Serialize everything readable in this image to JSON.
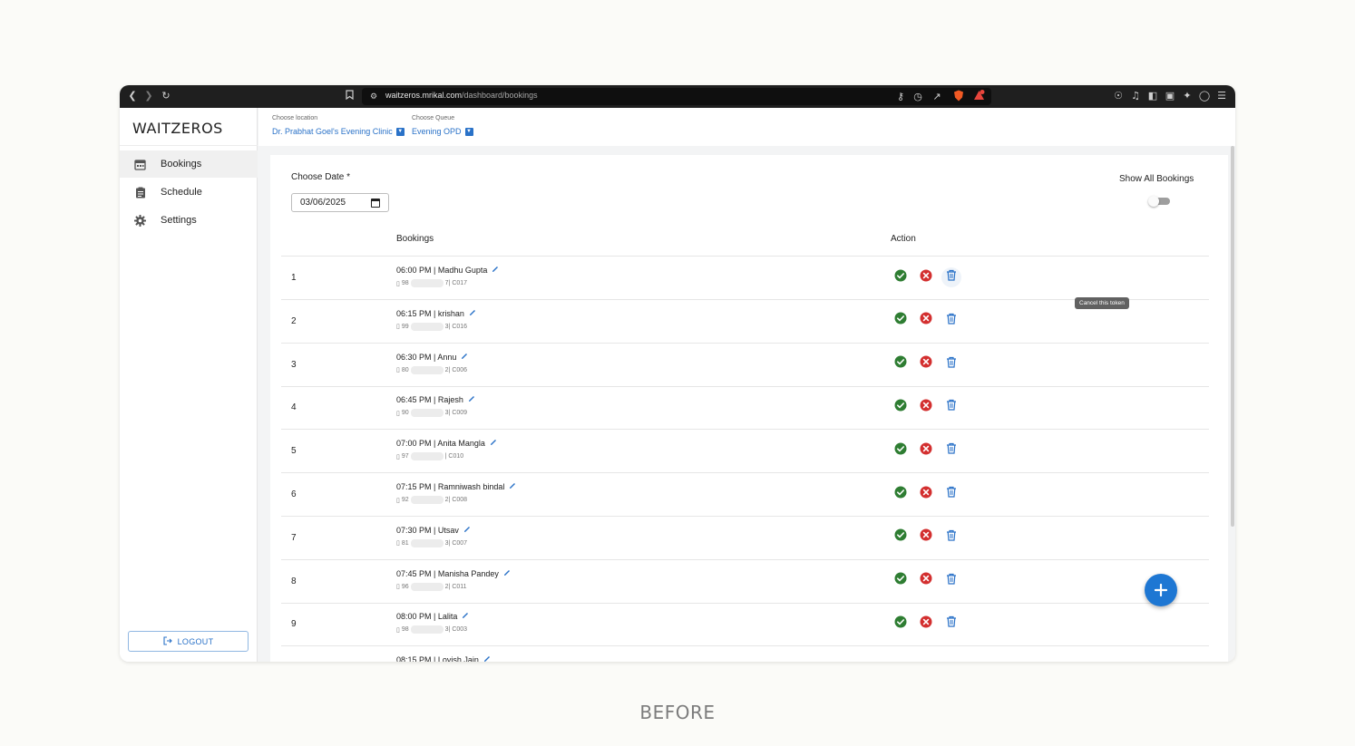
{
  "browser": {
    "url_host": "waitzeros.mrikal.com",
    "url_path": "/dashboard/bookings"
  },
  "sidebar": {
    "brand": "WAITZEROS",
    "items": [
      {
        "label": "Bookings",
        "icon": "calendar-icon",
        "active": true
      },
      {
        "label": "Schedule",
        "icon": "clipboard-icon",
        "active": false
      },
      {
        "label": "Settings",
        "icon": "gear-icon",
        "active": false
      }
    ],
    "logout_label": "LOGOUT"
  },
  "topbar": {
    "location_label": "Choose location",
    "location_value": "Dr. Prabhat Goel's Evening Clinic",
    "queue_label": "Choose Queue",
    "queue_value": "Evening OPD"
  },
  "filters": {
    "date_label": "Choose Date *",
    "date_value": "03/06/2025",
    "show_all_label": "Show All Bookings",
    "show_all_on": false
  },
  "table": {
    "headers": {
      "bookings": "Bookings",
      "action": "Action"
    },
    "rows": [
      {
        "index": "1",
        "title": "06:00 PM | Madhu Gupta",
        "phone_prefix": "98",
        "phone_end": "7",
        "code": "| C017"
      },
      {
        "index": "2",
        "title": "06:15 PM | krishan",
        "phone_prefix": "99",
        "phone_end": "3",
        "code": "| C016"
      },
      {
        "index": "3",
        "title": "06:30 PM | Annu",
        "phone_prefix": "80",
        "phone_end": "2",
        "code": "| C006"
      },
      {
        "index": "4",
        "title": "06:45 PM | Rajesh",
        "phone_prefix": "90",
        "phone_end": "3",
        "code": "| C009"
      },
      {
        "index": "5",
        "title": "07:00 PM | Anita Mangla",
        "phone_prefix": "97",
        "phone_end": "",
        "code": "| C010"
      },
      {
        "index": "6",
        "title": "07:15 PM | Ramniwash bindal",
        "phone_prefix": "92",
        "phone_end": "2",
        "code": "| C008"
      },
      {
        "index": "7",
        "title": "07:30 PM | Utsav",
        "phone_prefix": "81",
        "phone_end": "3",
        "code": "| C007"
      },
      {
        "index": "8",
        "title": "07:45 PM | Manisha Pandey",
        "phone_prefix": "96",
        "phone_end": "2",
        "code": "| C011"
      },
      {
        "index": "9",
        "title": "08:00 PM | Lalita",
        "phone_prefix": "98",
        "phone_end": "3",
        "code": "| C003"
      },
      {
        "index": "",
        "title": "08:15 PM | Lovish Jain",
        "phone_prefix": "",
        "phone_end": "",
        "code": ""
      }
    ]
  },
  "tooltip": "Cancel this token",
  "caption": "BEFORE",
  "colors": {
    "accent": "#1e77d3",
    "link": "#2a72c8",
    "confirm": "#2e7d32",
    "cancel": "#d32f2f",
    "toolbar": "#1f1f1f"
  }
}
